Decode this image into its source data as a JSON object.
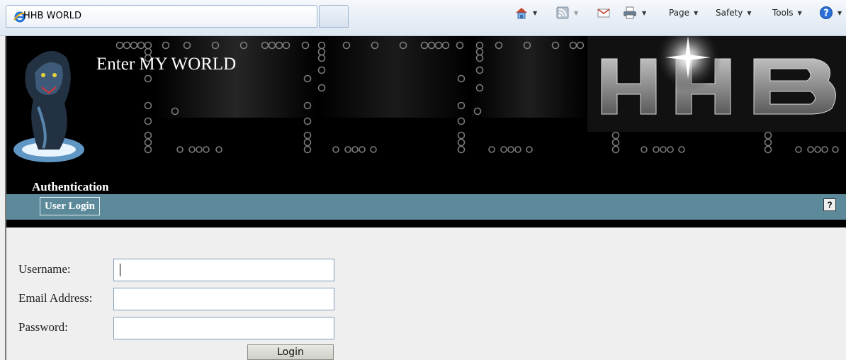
{
  "browser": {
    "tab_title": "HHB WORLD",
    "commands": {
      "home_icon": "home-icon",
      "feeds_icon": "feeds-icon",
      "mail_icon": "mail-icon",
      "print_icon": "print-icon",
      "page_label": "Page",
      "safety_label": "Safety",
      "tools_label": "Tools",
      "help_icon": "help-icon"
    }
  },
  "header": {
    "welcome_text": "Enter MY WORLD",
    "logo_text": "HHB",
    "section_title": "Authentication",
    "nav_tab_label": "User Login",
    "help_label": "?"
  },
  "form": {
    "username_label": "Username:",
    "username_value": "",
    "email_label": "Email Address:",
    "email_value": "",
    "password_label": "Password:",
    "password_value": "",
    "login_button_label": "Login"
  },
  "colors": {
    "nav_bar": "#5c8a9a",
    "header_bg": "#000000",
    "page_bg": "#efefef"
  }
}
